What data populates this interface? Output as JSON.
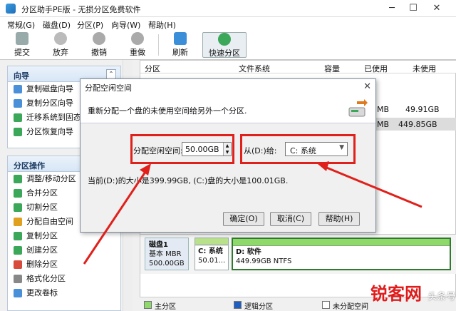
{
  "window": {
    "title": "分区助手PE版 - 无损分区免费软件",
    "minimize": "─",
    "maximize": "☐",
    "close": "✕"
  },
  "menu": [
    {
      "label": "常规(G)"
    },
    {
      "label": "磁盘(D)"
    },
    {
      "label": "分区(P)"
    },
    {
      "label": "向导(W)"
    },
    {
      "label": "帮助(H)"
    }
  ],
  "toolbar": {
    "submit": "提交",
    "discard": "放弃",
    "undo": "撤销",
    "redo": "重做",
    "refresh": "刷新",
    "quick_partition": "快速分区"
  },
  "wizard_panel": {
    "title": "向导",
    "collapse": "⌃",
    "items": [
      "复制磁盘向导",
      "复制分区向导",
      "迁移系统到固态",
      "分区恢复向导"
    ]
  },
  "ops_panel": {
    "title": "分区操作",
    "items": [
      "调整/移动分区",
      "合并分区",
      "切割分区",
      "分配自由空间",
      "复制分区",
      "创建分区",
      "删除分区",
      "格式化分区",
      "更改卷标"
    ]
  },
  "table": {
    "headers": [
      "分区",
      "文件系统",
      "容量",
      "已使用",
      "未使用"
    ],
    "rows": [
      {
        "used": "MB",
        "free": "49.91GB"
      },
      {
        "used": "MB",
        "free": "449.85GB"
      }
    ]
  },
  "disk": {
    "name": "磁盘1",
    "type": "基本 MBR",
    "size": "500.00GB",
    "part_c": {
      "label": "C: 系统",
      "size": "50.01..."
    },
    "part_d": {
      "label": "D: 软件",
      "size": "449.99GB NTFS"
    }
  },
  "legend": [
    "主分区",
    "逻辑分区",
    "未分配空间"
  ],
  "dialog": {
    "title": "分配空闲空间",
    "close": "✕",
    "description": "重新分配一个盘的未使用空间给另外一个分区.",
    "size_label": "分配空闲空间:",
    "size_value": "50.00GB",
    "from_label": "从(D:)给:",
    "from_value": "C: 系统",
    "status": "当前(D:)的大小是399.99GB, (C:)盘的大小是100.01GB.",
    "ok": "确定(O)",
    "cancel": "取消(C)",
    "help": "帮助(H)"
  },
  "watermark": {
    "brand": "锐客网",
    "sub": "头条号"
  },
  "colors": {
    "highlight_red": "#e0201b",
    "primary_partition": "#8fd86a",
    "logical_partition": "#1f5fc0"
  }
}
